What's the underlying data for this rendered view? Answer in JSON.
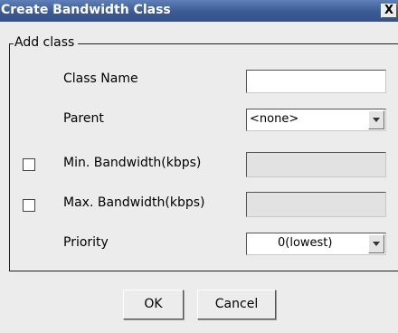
{
  "window": {
    "title": "Create Bandwidth Class",
    "close_label": "X"
  },
  "group": {
    "legend": "Add class"
  },
  "fields": {
    "class_name": {
      "label": "Class Name",
      "value": ""
    },
    "parent": {
      "label": "Parent",
      "value": "<none>"
    },
    "min_bandwidth": {
      "label": "Min. Bandwidth(kbps)",
      "checked": false,
      "value": ""
    },
    "max_bandwidth": {
      "label": "Max. Bandwidth(kbps)",
      "checked": false,
      "value": ""
    },
    "priority": {
      "label": "Priority",
      "value": "0(lowest)"
    }
  },
  "buttons": {
    "ok": "OK",
    "cancel": "Cancel"
  }
}
